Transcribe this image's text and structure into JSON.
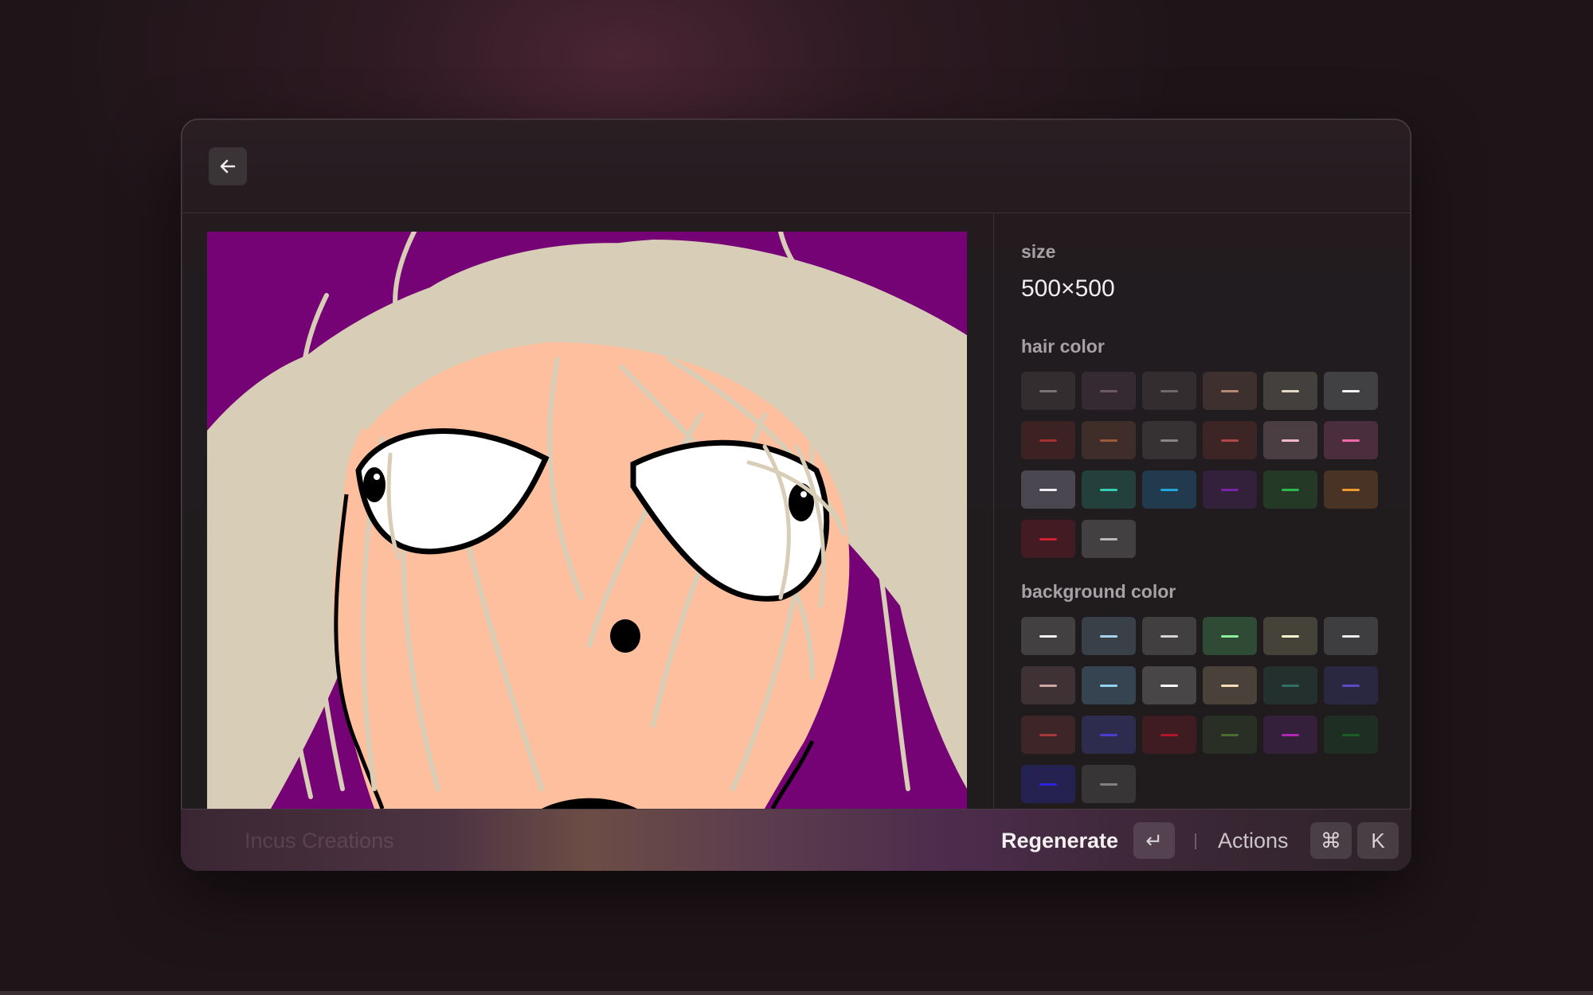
{
  "header": {
    "back_icon": "arrow-left-icon"
  },
  "options": {
    "size_label": "size",
    "size_value": "500×500",
    "hair_color_label": "hair color",
    "hair_colors": [
      {
        "bg": "#332d30",
        "line": "#7a7275"
      },
      {
        "bg": "#352a31",
        "line": "#6b5a63"
      },
      {
        "bg": "#332d30",
        "line": "#6e686b"
      },
      {
        "bg": "#3e302e",
        "line": "#b48a74"
      },
      {
        "bg": "#43403d",
        "line": "#e3dac6"
      },
      {
        "bg": "#414042",
        "line": "#f4f2f3"
      },
      {
        "bg": "#3d2224",
        "line": "#a4302f"
      },
      {
        "bg": "#3e2d29",
        "line": "#9c5a3a"
      },
      {
        "bg": "#363234",
        "line": "#8a8486"
      },
      {
        "bg": "#3e2525",
        "line": "#b34545"
      },
      {
        "bg": "#4b3e43",
        "line": "#f5b8c8"
      },
      {
        "bg": "#4b2e3e",
        "line": "#f06aa8"
      },
      {
        "bg": "#4a4750",
        "line": "#eeeef3"
      },
      {
        "bg": "#24403d",
        "line": "#38cdb5"
      },
      {
        "bg": "#213a4d",
        "line": "#22a9dc"
      },
      {
        "bg": "#33213b",
        "line": "#7a23a8"
      },
      {
        "bg": "#243a27",
        "line": "#2bb94a"
      },
      {
        "bg": "#483324",
        "line": "#ef9a2d"
      },
      {
        "bg": "#421c22",
        "line": "#d22033"
      },
      {
        "bg": "#434042",
        "line": "#bdb8bb"
      }
    ],
    "background_color_label": "background color",
    "background_colors": [
      {
        "bg": "#434042",
        "line": "#f4f2f3"
      },
      {
        "bg": "#394047",
        "line": "#a5d2ec"
      },
      {
        "bg": "#413f40",
        "line": "#d8d4d6"
      },
      {
        "bg": "#2f4b35",
        "line": "#8af09a"
      },
      {
        "bg": "#444239",
        "line": "#fbf5d0"
      },
      {
        "bg": "#3e3d40",
        "line": "#ececf0"
      },
      {
        "bg": "#3e3234",
        "line": "#cfa6a6"
      },
      {
        "bg": "#364451",
        "line": "#8fd3f2"
      },
      {
        "bg": "#484647",
        "line": "#ffffff"
      },
      {
        "bg": "#49413a",
        "line": "#f5dcb4"
      },
      {
        "bg": "#23302e",
        "line": "#2f6f66"
      },
      {
        "bg": "#2a2740",
        "line": "#5b4bc7"
      },
      {
        "bg": "#3e2628",
        "line": "#a83a3a"
      },
      {
        "bg": "#2d2b4e",
        "line": "#4a3ed1"
      },
      {
        "bg": "#3e1c21",
        "line": "#b3162c"
      },
      {
        "bg": "#2a2f25",
        "line": "#4d6b2e"
      },
      {
        "bg": "#34203a",
        "line": "#b026b5"
      },
      {
        "bg": "#1f2e23",
        "line": "#185f27"
      },
      {
        "bg": "#252251",
        "line": "#2a24e2"
      },
      {
        "bg": "#383537",
        "line": "#857f82"
      }
    ]
  },
  "footer": {
    "title": "Incus Creations",
    "primary_action": "Regenerate",
    "enter_key": "↵",
    "secondary_action": "Actions",
    "cmd_key": "⌘",
    "k_key": "K"
  }
}
